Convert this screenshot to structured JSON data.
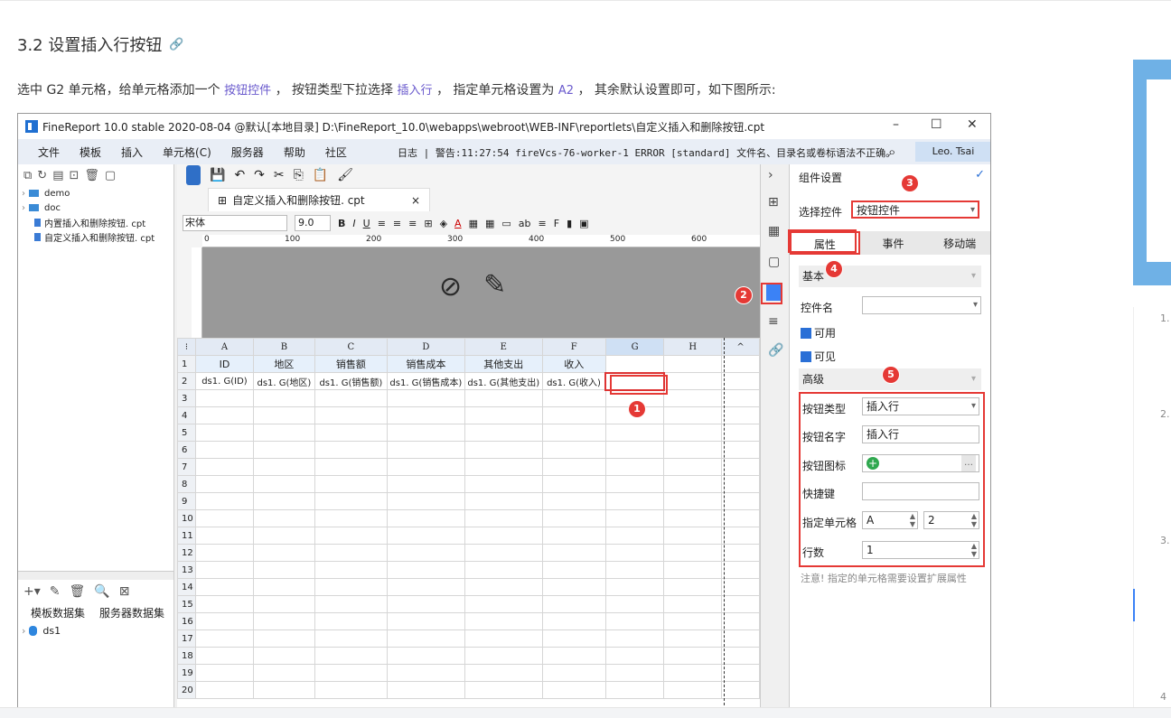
{
  "doc": {
    "title": "3.2 设置插入行按钮",
    "link_icon": "link-icon",
    "para_prefix": "选中 G2 单元格，给单元格添加一个",
    "para_hl1": "按钮控件",
    "para_mid1": "， 按钮类型下拉选择",
    "para_hl2": "插入行",
    "para_mid2": "， 指定单元格设置为",
    "para_hl3": "A2",
    "para_suffix": "， 其余默认设置即可，如下图所示:",
    "rail_numbers": [
      "1.",
      "2.",
      "3.",
      "4"
    ]
  },
  "app": {
    "title": "FineReport 10.0 stable 2020-08-04 @默认[本地目录]   D:\\FineReport_10.0\\webapps\\webroot\\WEB-INF\\reportlets\\自定义插入和删除按钮.cpt",
    "window_controls": [
      "–",
      "☐",
      "✕"
    ],
    "menu": [
      "文件",
      "模板",
      "插入",
      "单元格(C)",
      "服务器",
      "帮助",
      "社区"
    ],
    "log_text": "日志 | 警告:11:27:54 fireVcs-76-worker-1 ERROR [standard] 文件名、目录名或卷标语法不正确。",
    "user": "Leo. Tsai"
  },
  "tree": {
    "folders": [
      "demo",
      "doc"
    ],
    "files": [
      "内置插入和删除按钮. cpt",
      "自定义插入和删除按钮. cpt"
    ]
  },
  "datasets": {
    "tabs": [
      "模板数据集",
      "服务器数据集"
    ],
    "items": [
      "ds1"
    ]
  },
  "editor": {
    "tab_title": "自定义插入和删除按钮. cpt",
    "tab_close": "×",
    "font": "宋体",
    "size": "9.0",
    "ruler": [
      "0",
      "100",
      "200",
      "300",
      "400",
      "500",
      "600"
    ],
    "columns": [
      "A",
      "B",
      "C",
      "D",
      "E",
      "F",
      "G",
      "H"
    ],
    "row1": [
      "ID",
      "地区",
      "销售额",
      "销售成本",
      "其他支出",
      "收入",
      "",
      ""
    ],
    "row2": [
      "ds1. G(ID)",
      "ds1. G(地区)",
      "ds1. G(销售额)",
      "ds1. G(销售成本)",
      "ds1. G(其他支出)",
      "ds1. G(收入)",
      "",
      ""
    ],
    "row_numbers": [
      "1",
      "2",
      "3",
      "4",
      "5",
      "6",
      "7",
      "8",
      "9",
      "10",
      "11",
      "12",
      "13",
      "14",
      "15",
      "16",
      "17",
      "18",
      "19",
      "20"
    ]
  },
  "props": {
    "panel_title": "组件设置",
    "select_label": "选择控件",
    "select_value": "按钮控件",
    "tabs": [
      "属性",
      "事件",
      "移动端"
    ],
    "section_basic": "基本",
    "name_label": "控件名",
    "enabled": "可用",
    "visible": "可见",
    "section_adv": "高级",
    "btn_type_label": "按钮类型",
    "btn_type_value": "插入行",
    "btn_name_label": "按钮名字",
    "btn_name_value": "插入行",
    "btn_icon_label": "按钮图标",
    "hotkey_label": "快捷键",
    "cell_label": "指定单元格",
    "cell_col": "A",
    "cell_row": "2",
    "rows_label": "行数",
    "rows_value": "1",
    "note": "注意! 指定的单元格需要设置扩展属性"
  },
  "badges": [
    "1",
    "2",
    "3",
    "4",
    "5"
  ],
  "colors": {
    "accent": "#2a6fd6",
    "annotation": "#e53935"
  }
}
